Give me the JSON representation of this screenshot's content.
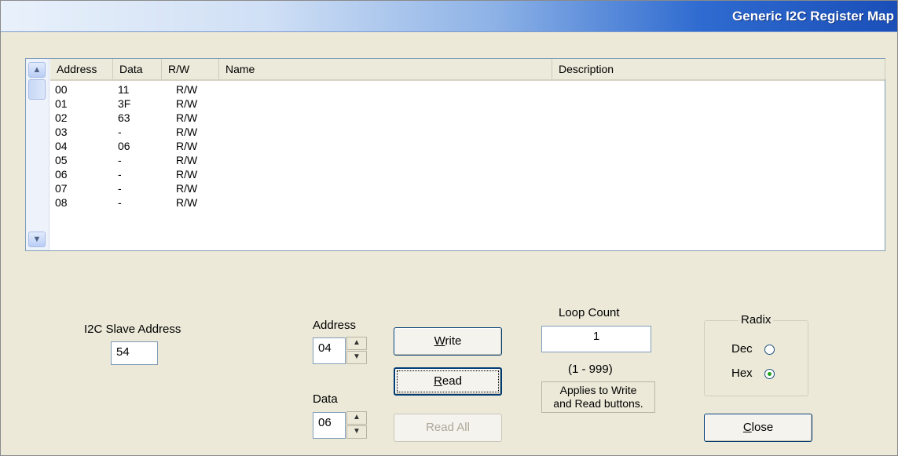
{
  "window": {
    "title": "Generic I2C Register Map"
  },
  "list": {
    "columns": [
      "Address",
      "Data",
      "R/W",
      "Name",
      "Description"
    ],
    "rows": [
      {
        "address": "00",
        "data": "11",
        "rw": "R/W"
      },
      {
        "address": "01",
        "data": "3F",
        "rw": "R/W"
      },
      {
        "address": "02",
        "data": "63",
        "rw": "R/W"
      },
      {
        "address": "03",
        "data": "-",
        "rw": "R/W"
      },
      {
        "address": "04",
        "data": "06",
        "rw": "R/W"
      },
      {
        "address": "05",
        "data": "-",
        "rw": "R/W"
      },
      {
        "address": "06",
        "data": "-",
        "rw": "R/W"
      },
      {
        "address": "07",
        "data": "-",
        "rw": "R/W"
      },
      {
        "address": "08",
        "data": "-",
        "rw": "R/W"
      }
    ]
  },
  "slave": {
    "label": "I2C Slave Address",
    "value": "54"
  },
  "address": {
    "label": "Address",
    "value": "04"
  },
  "data_field": {
    "label": "Data",
    "value": "06"
  },
  "buttons": {
    "write": "Write",
    "read": "Read",
    "read_all": "Read All",
    "close": "Close"
  },
  "loop": {
    "label": "Loop Count",
    "value": "1",
    "range": "(1 - 999)",
    "note_line1": "Applies to Write",
    "note_line2": "and Read buttons."
  },
  "radix": {
    "title": "Radix",
    "dec": "Dec",
    "hex": "Hex",
    "selected": "Hex"
  }
}
